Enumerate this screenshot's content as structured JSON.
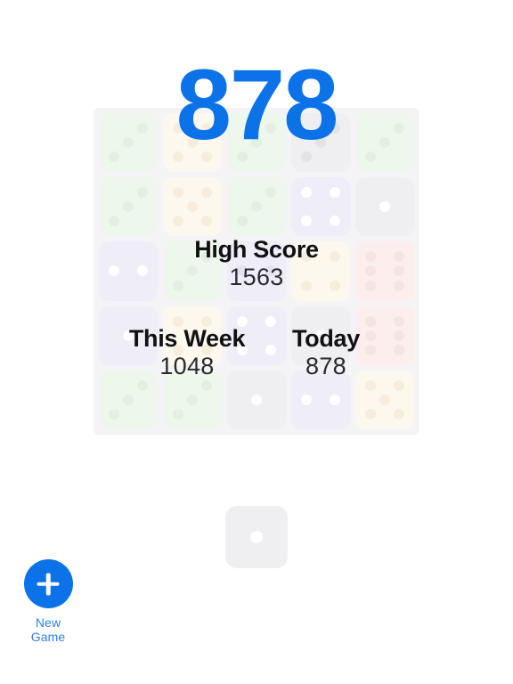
{
  "app": {
    "background_color": "#ffffff",
    "accent_color": "#0b72e8"
  },
  "score": {
    "current": "878"
  },
  "stats": [
    {
      "label": "High Score",
      "value": "1563"
    },
    {
      "label": "This Week",
      "value": "1048"
    },
    {
      "label": "Today",
      "value": "878"
    }
  ],
  "board": {
    "rows": 5,
    "cols": 5,
    "die_colors": {
      "green": {
        "face": "#eef7ec",
        "pip": "#e3f0e0"
      },
      "cream": {
        "face": "#fdf8ee",
        "pip": "#f6eddd"
      },
      "lavender": {
        "face": "#eeedf8",
        "pip": "#ffffff"
      },
      "lavender_faded": {
        "face": "#eeedf8",
        "pip": "#e4e2f2"
      },
      "gray": {
        "face": "#efeff1",
        "pip": "#ffffff"
      },
      "gray_faded": {
        "face": "#efeff1",
        "pip": "#e3e3e6"
      },
      "pink": {
        "face": "#fdeeee",
        "pip": "#f6e3e3"
      }
    },
    "cells": [
      {
        "color": "green",
        "value": 3
      },
      {
        "color": "cream",
        "value": 5
      },
      {
        "color": "green",
        "value": 3
      },
      {
        "color": "gray_faded",
        "value": 3
      },
      {
        "color": "green",
        "value": 3
      },
      {
        "color": "green",
        "value": 3
      },
      {
        "color": "cream",
        "value": 5
      },
      {
        "color": "green",
        "value": 3
      },
      {
        "color": "lavender",
        "value": 4
      },
      {
        "color": "gray",
        "value": 1
      },
      {
        "color": "lavender",
        "value": 2
      },
      {
        "color": "green",
        "value": 3
      },
      {
        "color": "lavender_faded",
        "value": 2
      },
      {
        "color": "cream",
        "value": 4
      },
      {
        "color": "pink",
        "value": 6
      },
      {
        "color": "lavender",
        "value": 1
      },
      {
        "color": "cream",
        "value": 5
      },
      {
        "color": "lavender",
        "value": 4
      },
      {
        "color": "gray",
        "value": 1
      },
      {
        "color": "pink",
        "value": 6
      },
      {
        "color": "green",
        "value": 3
      },
      {
        "color": "green",
        "value": 3
      },
      {
        "color": "gray",
        "value": 1
      },
      {
        "color": "lavender",
        "value": 2
      },
      {
        "color": "cream",
        "value": 5
      }
    ]
  },
  "next_die": {
    "color": "gray",
    "value": 1
  },
  "new_game": {
    "label": "New Game",
    "icon": "plus-icon"
  }
}
